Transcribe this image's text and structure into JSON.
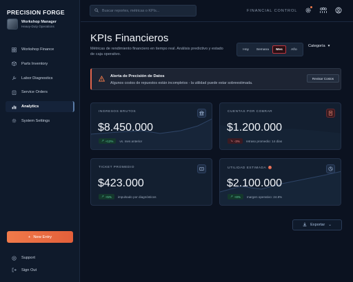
{
  "brand": "PRECISION FORGE",
  "user": {
    "name": "Workshop Manager",
    "role": "Heavy-Duty Operations"
  },
  "nav": [
    {
      "label": "Workshop Finance",
      "icon": "grid-icon"
    },
    {
      "label": "Parts Inventory",
      "icon": "box-icon"
    },
    {
      "label": "Labor Diagnostics",
      "icon": "wrench-icon"
    },
    {
      "label": "Service Orders",
      "icon": "clipboard-icon"
    },
    {
      "label": "Analytics",
      "icon": "bar-chart-icon",
      "active": true
    },
    {
      "label": "System Settings",
      "icon": "gear-icon"
    }
  ],
  "new_entry": "New Entry",
  "bottom_nav": [
    {
      "label": "Support",
      "icon": "help-icon"
    },
    {
      "label": "Sign Out",
      "icon": "logout-icon"
    }
  ],
  "topbar": {
    "search_placeholder": "Buscar reportes, métricas o KPIs...",
    "section": "FINANCIAL CONTROL"
  },
  "header": {
    "title": "KPIs Financieros",
    "subtitle": "Métricas de rendimiento financiero en tiempo real. Análisis predictivo y estado de caja operativo.",
    "periods": [
      "Hoy",
      "Semana",
      "Mes",
      "Año"
    ],
    "selected_period": "Mes",
    "category": "Categoría"
  },
  "alert": {
    "title": "Alerta de Precisión de Datos",
    "message": "Algunos costos de repuestos están incompletos - la utilidad puede estar sobreestimada.",
    "button": "Revisar Costos"
  },
  "cards": [
    {
      "label": "INGRESOS BRUTOS",
      "value": "$8.450.000",
      "badge": "+12%",
      "trend": "up",
      "note": "vs. mes anterior",
      "icon": "bank-icon",
      "accent": "#3f6fb0"
    },
    {
      "label": "CUENTAS POR COBRAR",
      "value": "$1.200.000",
      "badge": "-3%",
      "trend": "down",
      "note": "retraso promedio: 14 días",
      "icon": "document-icon",
      "accent": "#c0363f"
    },
    {
      "label": "TICKET PROMEDIO",
      "value": "$423.000",
      "badge": "+5%",
      "trend": "up",
      "note": "impulsado por diagnósticos",
      "icon": "ticket-icon",
      "accent": "#3f6fb0"
    },
    {
      "label": "UTILIDAD ESTIMADA",
      "value": "$2.100.000",
      "badge": "+8%",
      "trend": "up",
      "note": "margen operativo: 24.8%",
      "icon": "pie-icon",
      "accent": "#3f6fb0",
      "info": "!"
    }
  ],
  "export": "Exportar",
  "colors": {
    "accent": "#f07a4a",
    "positive": "#5fd3a0",
    "negative": "#f08a8a",
    "background": "#0b1220"
  }
}
